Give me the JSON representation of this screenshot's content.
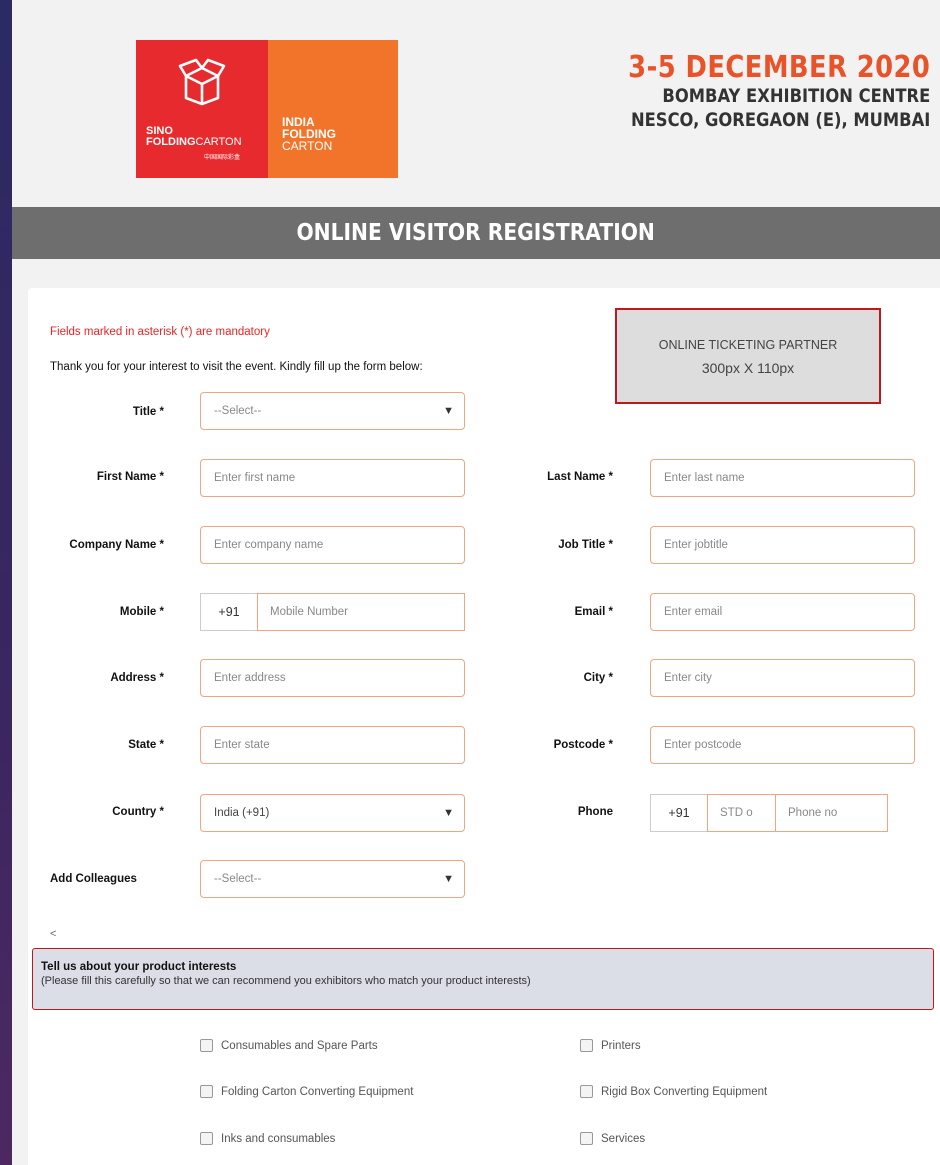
{
  "logo": {
    "sino": "SINO",
    "folding": "FOLDING",
    "carton": "CARTON",
    "cn": "中国国际彩盒",
    "india": "INDIA",
    "folding2": "FOLDING",
    "carton2": "CARTON"
  },
  "event": {
    "date": "3-5 DECEMBER 2020",
    "venue1": "BOMBAY EXHIBITION CENTRE",
    "venue2": "NESCO, GOREGAON (E), MUMBAI"
  },
  "banner": "ONLINE VISITOR REGISTRATION",
  "form": {
    "mandatory_note": "Fields marked in asterisk (*) are mandatory",
    "intro": "Thank you for your interest to visit the event. Kindly fill up the form below:",
    "partner_line1": "ONLINE TICKETING PARTNER",
    "partner_line2": "300px X 110px",
    "title_label": "Title *",
    "title_value": "--Select--",
    "first_label": "First Name *",
    "first_ph": "Enter first name",
    "last_label": "Last Name *",
    "last_ph": "Enter last name",
    "company_label": "Company Name *",
    "company_ph": "Enter company name",
    "job_label": "Job Title *",
    "job_ph": "Enter jobtitle",
    "mobile_label": "Mobile *",
    "mobile_code": "+91",
    "mobile_ph": "Mobile Number",
    "email_label": "Email *",
    "email_ph": "Enter email",
    "address_label": "Address *",
    "address_ph": "Enter address",
    "city_label": "City *",
    "city_ph": "Enter city",
    "state_label": "State *",
    "state_ph": "Enter state",
    "postcode_label": "Postcode *",
    "postcode_ph": "Enter postcode",
    "country_label": "Country *",
    "country_value": "India (+91)",
    "phone_label": "Phone",
    "phone_code": "+91",
    "phone_std": "STD o",
    "phone_ph": "Phone no",
    "colleagues_label": "Add Colleagues",
    "colleagues_value": "--Select--",
    "lt": "<"
  },
  "interests": {
    "title": "Tell us about your product interests",
    "subtitle": "(Please fill this carefully so that we can recommend you exhibitors who match your product interests)",
    "options": [
      "Consumables and Spare Parts",
      "Printers",
      "Folding Carton Converting Equipment",
      "Rigid Box Converting Equipment",
      "Inks and consumables",
      "Services"
    ]
  },
  "colors": {
    "accent": "#e8532a",
    "banner": "#6e6e6e",
    "required": "#ee2222"
  }
}
